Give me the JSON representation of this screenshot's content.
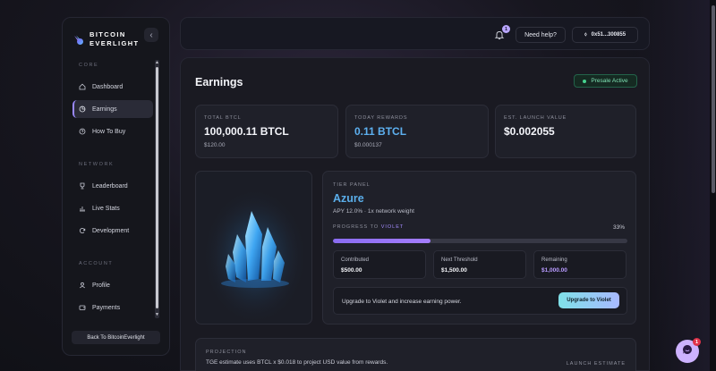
{
  "sidebar": {
    "brand": {
      "line1": "BITCOIN",
      "line2": "EVERLIGHT"
    },
    "collapse_icon": "chevron-left-icon",
    "sections": [
      {
        "title": "CORE",
        "items": [
          {
            "label": "Dashboard",
            "icon": "home-icon"
          },
          {
            "label": "Earnings",
            "icon": "pie-chart-icon",
            "active": true
          },
          {
            "label": "How To Buy",
            "icon": "help-circle-icon"
          }
        ]
      },
      {
        "title": "NETWORK",
        "items": [
          {
            "label": "Leaderboard",
            "icon": "trophy-icon"
          },
          {
            "label": "Live Stats",
            "icon": "bar-chart-icon"
          },
          {
            "label": "Development",
            "icon": "refresh-icon"
          }
        ]
      },
      {
        "title": "ACCOUNT",
        "items": [
          {
            "label": "Profile",
            "icon": "user-icon"
          },
          {
            "label": "Payments",
            "icon": "wallet-icon"
          }
        ]
      }
    ],
    "back_button": "Back To BitcoinEverlight"
  },
  "topbar": {
    "notification_count": "1",
    "help_label": "Need help?",
    "wallet_label": "0x51...300855"
  },
  "main": {
    "title": "Earnings",
    "status_badge": "Presale Active",
    "status_color": "#46d38f",
    "stats": [
      {
        "label": "TOTAL BTCL",
        "value": "100,000.11 BTCL",
        "sub": "$120.00"
      },
      {
        "label": "TODAY REWARDS",
        "value": "0.11 BTCL",
        "sub": "$0.000137"
      },
      {
        "label": "EST. LAUNCH VALUE",
        "value": "$0.002055",
        "sub": ""
      }
    ],
    "tier": {
      "panel_label": "TIER PANEL",
      "name": "Azure",
      "apy_text": "APY 12.0% · 1x network weight",
      "progress_label": "PROGRESS TO",
      "progress_target": "VIOLET",
      "progress_pct_text": "33%",
      "progress_value": 0.33,
      "metrics": [
        {
          "label": "Contributed",
          "value": "$500.00"
        },
        {
          "label": "Next Threshold",
          "value": "$1,500.00"
        },
        {
          "label": "Remaining",
          "value": "$1,000.00"
        }
      ],
      "upgrade_text": "Upgrade to Violet and increase earning power.",
      "upgrade_button": "Upgrade to Violet"
    },
    "projection": {
      "label": "PROJECTION",
      "text": "TGE estimate uses BTCL x $0.018 to project USD value from rewards.",
      "right_label": "LAUNCH ESTIMATE"
    }
  },
  "chat": {
    "icon": "chat-bubble-icon",
    "badge": "1"
  },
  "colors": {
    "accent_purple": "#a47dff",
    "accent_blue": "#5aaeea",
    "success_green": "#46d38f"
  }
}
